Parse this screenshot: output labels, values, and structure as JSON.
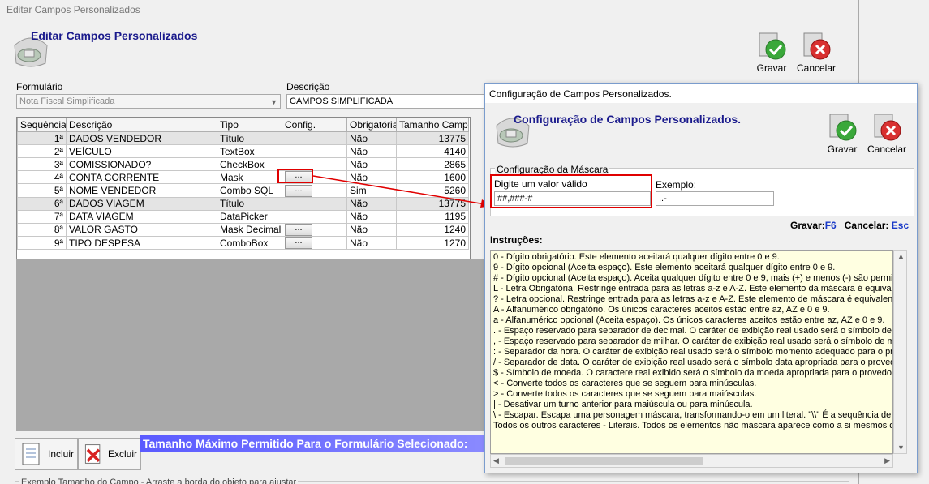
{
  "main": {
    "window_title": "Editar Campos Personalizados",
    "header_title": "Editar Campos Personalizados",
    "toolbar": {
      "save_label": "Gravar",
      "cancel_label": "Cancelar"
    },
    "form_label": "Formulário",
    "form_value": "Nota Fiscal Simplificada",
    "desc_label": "Descrição",
    "desc_value": "CAMPOS SIMPLIFICADA",
    "grid": {
      "headers": [
        "Sequência",
        "Descrição",
        "Tipo",
        "Config.",
        "Obrigatória",
        "Tamanho Campo"
      ],
      "rows": [
        {
          "seq": "1ª",
          "desc": "DADOS VENDEDOR",
          "tipo": "Título",
          "config": false,
          "obrig": "Não",
          "tam": "13775",
          "title": true
        },
        {
          "seq": "2ª",
          "desc": "VEÍCULO",
          "tipo": "TextBox",
          "config": false,
          "obrig": "Não",
          "tam": "4140",
          "title": false
        },
        {
          "seq": "3ª",
          "desc": "COMISSIONADO?",
          "tipo": "CheckBox",
          "config": false,
          "obrig": "Não",
          "tam": "2865",
          "title": false
        },
        {
          "seq": "4ª",
          "desc": "CONTA CORRENTE",
          "tipo": "Mask",
          "config": true,
          "obrig": "Não",
          "tam": "1600",
          "title": false
        },
        {
          "seq": "5ª",
          "desc": "NOME VENDEDOR",
          "tipo": "Combo SQL",
          "config": true,
          "obrig": "Sim",
          "tam": "5260",
          "title": false
        },
        {
          "seq": "6ª",
          "desc": "DADOS VIAGEM",
          "tipo": "Título",
          "config": false,
          "obrig": "Não",
          "tam": "13775",
          "title": true
        },
        {
          "seq": "7ª",
          "desc": "DATA VIAGEM",
          "tipo": "DataPicker",
          "config": false,
          "obrig": "Não",
          "tam": "1195",
          "title": false
        },
        {
          "seq": "8ª",
          "desc": "VALOR GASTO",
          "tipo": "Mask Decimal",
          "config": true,
          "obrig": "Não",
          "tam": "1240",
          "title": false
        },
        {
          "seq": "9ª",
          "desc": "TIPO DESPESA",
          "tipo": "ComboBox",
          "config": true,
          "obrig": "Não",
          "tam": "1270",
          "title": false
        }
      ],
      "config_button_label": "..."
    },
    "include_label": "Incluir",
    "exclude_label": "Excluir",
    "banner": "Tamanho Máximo Permitido Para o Formulário Selecionado:",
    "bottom_group": "Exemplo Tamanho do Campo - Arraste a borda do objeto para ajustar"
  },
  "dialog": {
    "window_title": "Configuração de Campos Personalizados.",
    "header_title": "Configuração de Campos Personalizados.",
    "toolbar": {
      "save_label": "Gravar",
      "cancel_label": "Cancelar"
    },
    "group_title": "Configuração da Máscara",
    "mask_label": "Digite um valor válido",
    "mask_value": "##,###-#",
    "example_label": "Exemplo:",
    "example_value": ",.-",
    "shortcut_save_label": "Gravar:",
    "shortcut_save_key": "F6",
    "shortcut_cancel_label": "Cancelar:",
    "shortcut_cancel_key": "Esc",
    "instructions_label": "Instruções:",
    "instructions": [
      "0 - Dígito obrigatório. Este elemento aceitará qualquer dígito entre 0 e 9.",
      "9 - Dígito opcional (Aceita espaço). Este elemento aceitará qualquer dígito entre 0 e 9.",
      "# - Dígito opcional (Aceita espaço). Aceita qualquer dígito entre 0 e 9, mais (+) e menos (-) são permitidos",
      "L - Letra Obrigatória. Restringe entrada para as letras a-z e A-Z. Este elemento da máscara é equivalente",
      "? - Letra opcional. Restringe entrada para as letras a-z e A-Z. Este elemento de máscara é equivalente a",
      "A - Alfanumérico obrigatório. Os únicos caracteres aceitos estão entre az, AZ e 0 e 9.",
      "a - Alfanumérico opcional (Aceita espaço). Os únicos caracteres aceitos estão entre az, AZ e 0 e 9.",
      ". - Espaço reservado para separador de decimal. O caráter de exibição real usado será o símbolo decima",
      ", - Espaço reservado para separador de milhar. O caráter de exibição real usado será o símbolo de milhar",
      ": - Separador da hora. O caráter de exibição real usado será o símbolo momento adequado para o provec",
      "/ - Separador de data. O caráter de exibição real usado será o símbolo data apropriada para o provedor d",
      "$ - Símbolo de moeda. O caractere real exibido será o símbolo da moeda apropriada para o provedor de",
      "< - Converte todos os caracteres que se seguem para minúsculas.",
      "> - Converte todos os caracteres que se seguem para maiúsculas.",
      "| - Desativar um turno anterior para maiúscula ou para minúscula.",
      "\\ - Escapar. Escapa uma personagem máscara, transformando-o em um literal. \"\\\\\" É a sequência de esc",
      "Todos os outros caracteres - Literais. Todos os elementos não máscara aparece como a si mesmos dentr"
    ]
  },
  "colors": {
    "header_blue": "#1a1a8c",
    "highlight_red": "#e00000",
    "banner": "#6a6aff",
    "instructions_bg": "#ffffe1"
  }
}
